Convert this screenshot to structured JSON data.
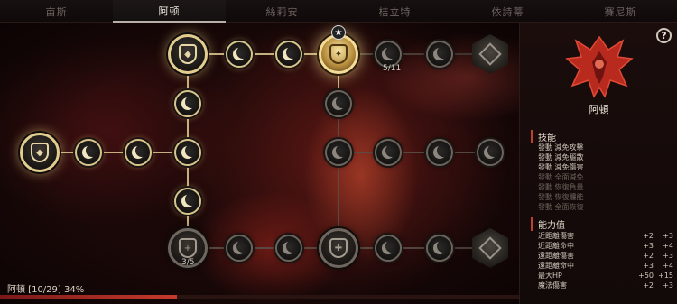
{
  "tabs": [
    "亩斯",
    "阿顿",
    "絲莉安",
    "桔立特",
    "依詩蒂",
    "賽尼斯"
  ],
  "active_tab": 1,
  "map": {
    "counter_top": "5/11",
    "counter_bottom": "3/5",
    "status_text": "阿頓 [10/29] 34%",
    "progress": 0.34
  },
  "panel": {
    "help": "?",
    "hero_name": "阿頓",
    "skills_title": "技能",
    "skills": [
      {
        "text": "發動 減免攻擊",
        "active": true
      },
      {
        "text": "發動 減免驅散",
        "active": true
      },
      {
        "text": "發動 減免傷害",
        "active": true
      },
      {
        "text": "發動 全面減免",
        "active": false
      },
      {
        "text": "發動 恢復負量",
        "active": false
      },
      {
        "text": "發動 恢復體能",
        "active": false
      },
      {
        "text": "發動 全面恢復",
        "active": false
      }
    ],
    "stats_title": "能力值",
    "stats": [
      {
        "name": "近距離傷害",
        "a": "+2",
        "b": "+3"
      },
      {
        "name": "近距離命中",
        "a": "+3",
        "b": "+4"
      },
      {
        "name": "遠距離傷害",
        "a": "+2",
        "b": "+3"
      },
      {
        "name": "遠距離命中",
        "a": "+3",
        "b": "+4"
      },
      {
        "name": "最大HP",
        "a": "+50",
        "b": "+15"
      },
      {
        "name": "魔法傷害",
        "a": "+2",
        "b": "+3"
      }
    ]
  },
  "colors": {
    "accent": "#c0402f",
    "gold": "#e2cd8f"
  }
}
